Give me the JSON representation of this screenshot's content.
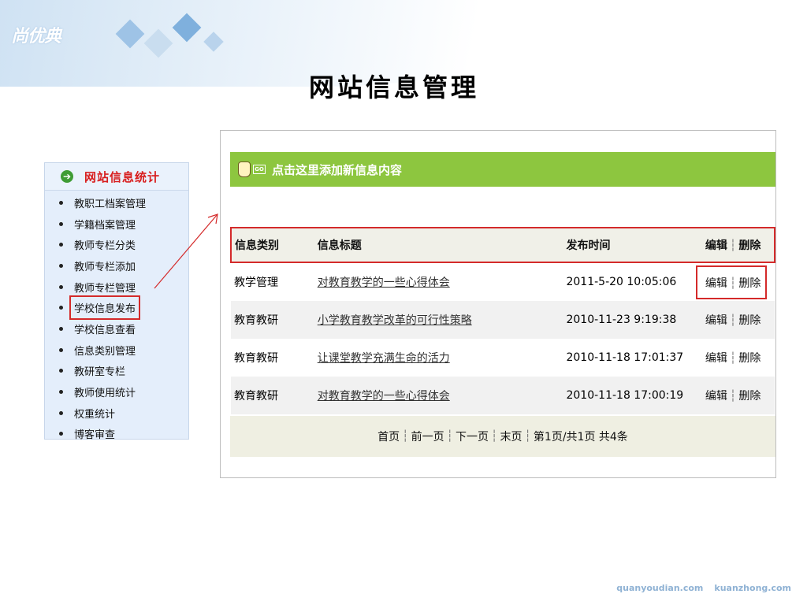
{
  "header": {
    "logo_text": "尚优典",
    "title": "网站信息管理"
  },
  "sidebar": {
    "title": "网站信息统计",
    "items": [
      {
        "label": "教职工档案管理"
      },
      {
        "label": "学籍档案管理"
      },
      {
        "label": "教师专栏分类"
      },
      {
        "label": "教师专栏添加"
      },
      {
        "label": "教师专栏管理"
      },
      {
        "label": "学校信息发布",
        "highlighted": true
      },
      {
        "label": "学校信息查看"
      },
      {
        "label": "信息类别管理"
      },
      {
        "label": "教研室专栏"
      },
      {
        "label": "教师使用统计"
      },
      {
        "label": "权重统计"
      },
      {
        "label": "博客审查"
      }
    ]
  },
  "panel": {
    "add_link": "点击这里添加新信息内容",
    "go_icon_text": "GO",
    "columns": [
      "信息类别",
      "信息标题",
      "发布时间",
      "编辑",
      "删除"
    ],
    "rows": [
      {
        "category": "教学管理",
        "title": "对教育教学的一些心得体会",
        "time": "2011-5-20 10:05:06",
        "edit": "编辑",
        "delete": "删除"
      },
      {
        "category": "教育教研",
        "title": "小学教育教学改革的可行性策略",
        "time": "2010-11-23 9:19:38",
        "edit": "编辑",
        "delete": "删除"
      },
      {
        "category": "教育教研",
        "title": "让课堂教学充满生命的活力",
        "time": "2010-11-18 17:01:37",
        "edit": "编辑",
        "delete": "删除"
      },
      {
        "category": "教育教研",
        "title": "对教育教学的一些心得体会",
        "time": "2010-11-18 17:00:19",
        "edit": "编辑",
        "delete": "删除"
      }
    ],
    "pager": {
      "first": "首页",
      "prev": "前一页",
      "next": "下一页",
      "last": "末页",
      "status": "第1页/共1页 共4条"
    }
  },
  "footer": {
    "site1": "quanyoudian.com",
    "site2": "kuanzhong.com"
  },
  "colors": {
    "accent_green": "#8dc63f",
    "highlight_red": "#d42a2a",
    "sidebar_title_red": "#d81e1e"
  }
}
